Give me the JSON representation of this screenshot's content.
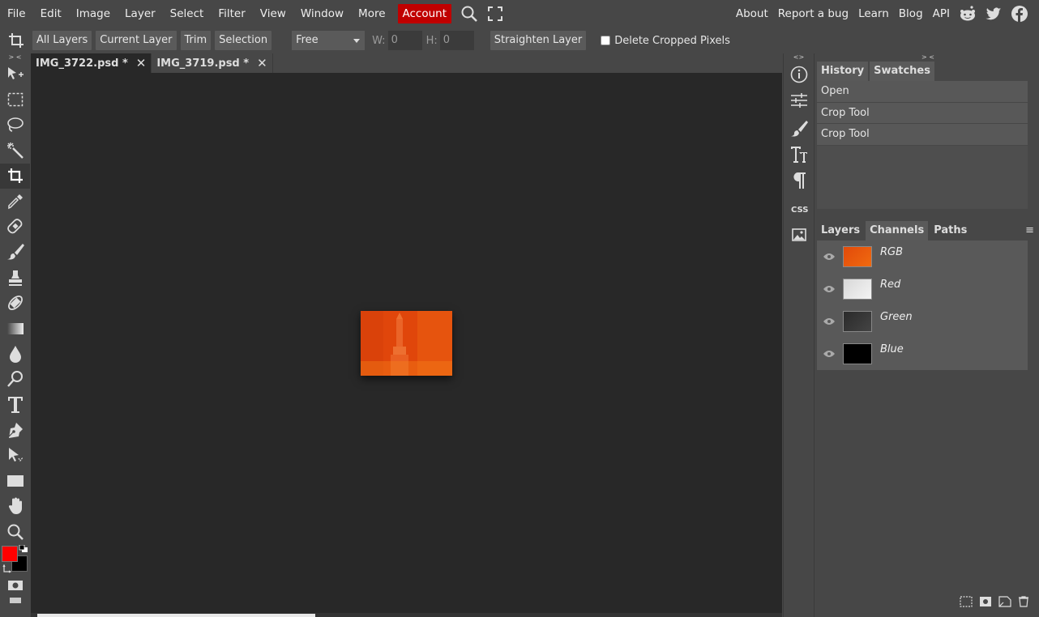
{
  "menu": {
    "items": [
      "File",
      "Edit",
      "Image",
      "Layer",
      "Select",
      "Filter",
      "View",
      "Window",
      "More"
    ],
    "account": "Account",
    "right_items": [
      "About",
      "Report a bug",
      "Learn",
      "Blog",
      "API"
    ]
  },
  "options": {
    "all_layers": "All Layers",
    "current_layer": "Current Layer",
    "trim": "Trim",
    "selection": "Selection",
    "mode": "Free",
    "w_label": "W:",
    "w_value": "0",
    "h_label": "H:",
    "h_value": "0",
    "straighten": "Straighten Layer",
    "delete_cropped": "Delete Cropped Pixels"
  },
  "collapse": {
    "left": "> <",
    "mid": "<>",
    "right": "> <"
  },
  "tabs": [
    {
      "label": "IMG_3722.psd *"
    },
    {
      "label": "IMG_3719.psd *"
    }
  ],
  "history_panel": {
    "tabs": [
      "History",
      "Swatches"
    ],
    "items": [
      "Open",
      "Crop Tool",
      "Crop Tool"
    ]
  },
  "channels_panel": {
    "tabs": [
      "Layers",
      "Channels",
      "Paths"
    ],
    "channels": [
      {
        "name": "RGB"
      },
      {
        "name": "Red"
      },
      {
        "name": "Green"
      },
      {
        "name": "Blue"
      }
    ]
  },
  "colors": {
    "foreground": "#ff0000",
    "background": "#000000",
    "accent": "#c00000"
  }
}
